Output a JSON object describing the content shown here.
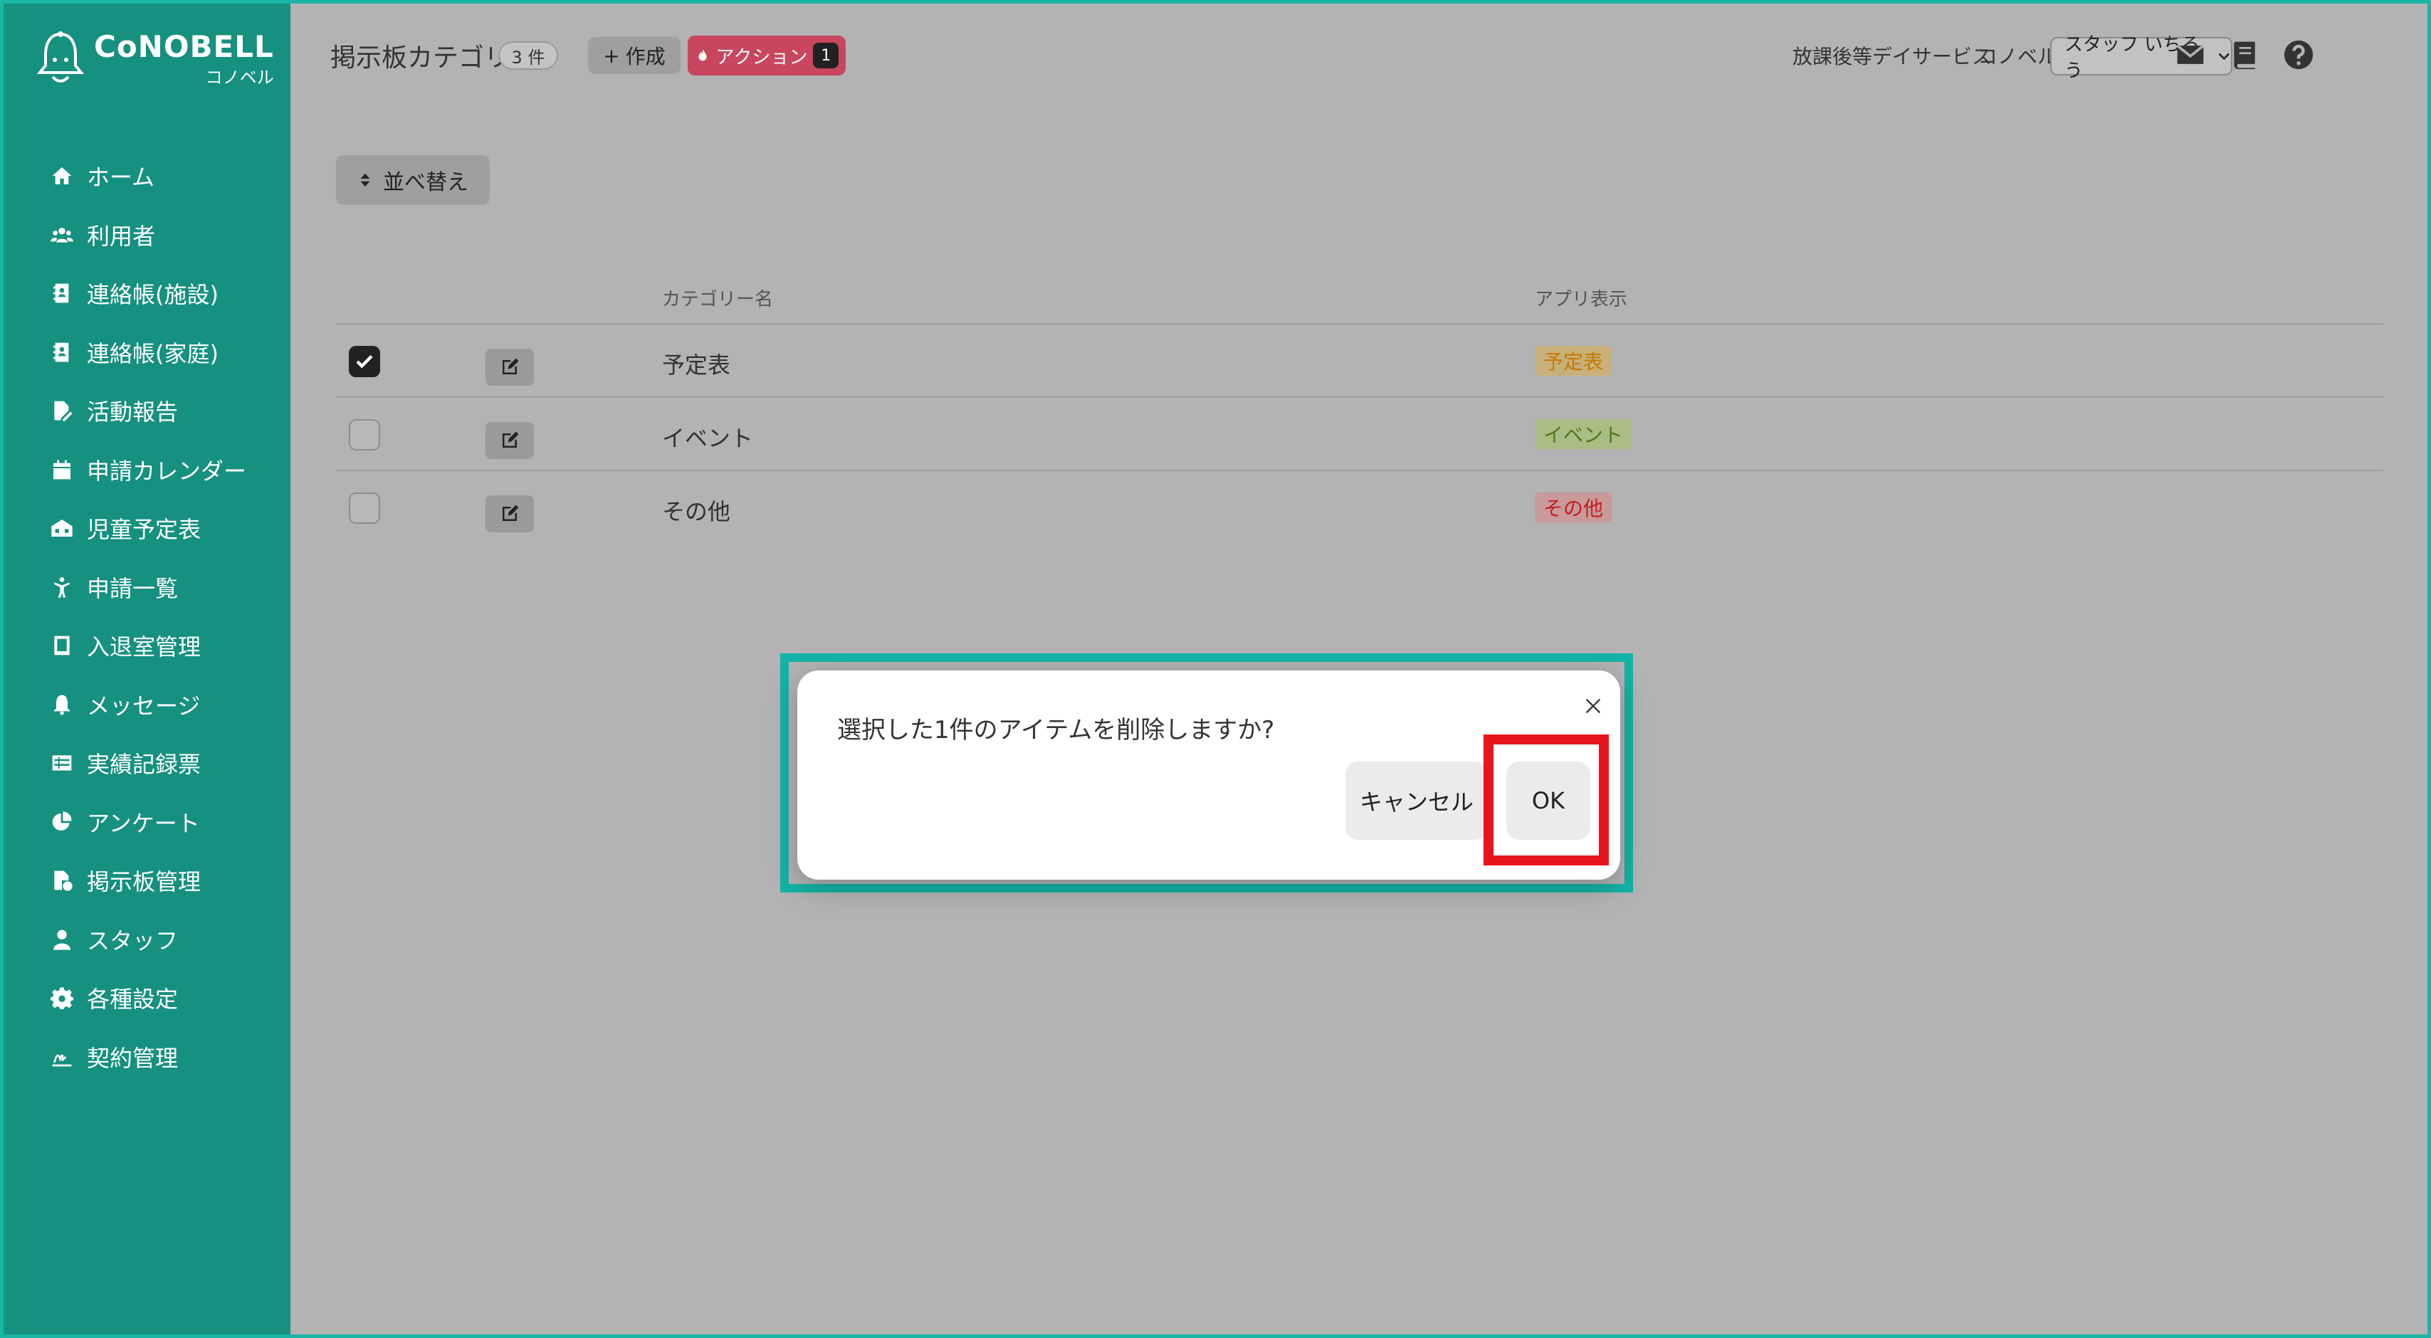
{
  "brand": {
    "name": "CoNOBELL",
    "sub": "コノベル"
  },
  "sidebar": {
    "items": [
      {
        "label": "ホーム",
        "icon": "home-icon"
      },
      {
        "label": "利用者",
        "icon": "users-icon"
      },
      {
        "label": "連絡帳(施設)",
        "icon": "contact-book-icon"
      },
      {
        "label": "連絡帳(家庭)",
        "icon": "contact-book-icon"
      },
      {
        "label": "活動報告",
        "icon": "report-icon"
      },
      {
        "label": "申請カレンダー",
        "icon": "calendar-icon"
      },
      {
        "label": "児童予定表",
        "icon": "schedule-icon"
      },
      {
        "label": "申請一覧",
        "icon": "child-icon"
      },
      {
        "label": "入退室管理",
        "icon": "tablet-icon"
      },
      {
        "label": "メッセージ",
        "icon": "bell-icon"
      },
      {
        "label": "実績記録票",
        "icon": "table-icon"
      },
      {
        "label": "アンケート",
        "icon": "pie-chart-icon"
      },
      {
        "label": "掲示板管理",
        "icon": "board-icon"
      },
      {
        "label": "スタッフ",
        "icon": "staff-icon"
      },
      {
        "label": "各種設定",
        "icon": "gear-icon"
      },
      {
        "label": "契約管理",
        "icon": "contract-icon"
      }
    ]
  },
  "header": {
    "title": "掲示板カテゴリ",
    "count": "3 件",
    "create_label": "作成",
    "action_label": "アクション",
    "action_count": "1",
    "facility": "放課後等デイサービス",
    "org": "コノベル",
    "staff": "スタッフ いちろう"
  },
  "main": {
    "sort_label": "並べ替え",
    "columns": {
      "name": "カテゴリー名",
      "display": "アプリ表示"
    },
    "rows": [
      {
        "name": "予定表",
        "tag": "予定表",
        "checked": true,
        "tag_bg": "#c9b07a",
        "tag_color": "#c47a00"
      },
      {
        "name": "イベント",
        "tag": "イベント",
        "checked": false,
        "tag_bg": "#a9bd85",
        "tag_color": "#4f7a17"
      },
      {
        "name": "その他",
        "tag": "その他",
        "checked": false,
        "tag_bg": "#c89a9a",
        "tag_color": "#c41d1d"
      }
    ]
  },
  "dialog": {
    "message": "選択した1件のアイテムを削除しますか?",
    "cancel_label": "キャンセル",
    "ok_label": "OK"
  },
  "colors": {
    "sidebar": "#16907f",
    "accent": "#14b3a7",
    "action": "#c8465e",
    "highlight": "#e8141b"
  }
}
